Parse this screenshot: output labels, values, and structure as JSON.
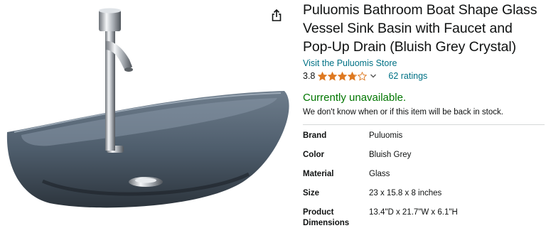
{
  "product": {
    "title": "Puluomis Bathroom Boat Shape Glass Vessel Sink Basin with Faucet and Pop-Up Drain (Bluish Grey Crystal)",
    "store_link": "Visit the Puluomis Store",
    "rating": {
      "value": "3.8",
      "stars": 3.8,
      "out_of": 5,
      "count_label": "62 ratings"
    },
    "availability": {
      "status": "Currently unavailable.",
      "note": "We don't know when or if this item will be back in stock."
    },
    "specs": [
      {
        "label": "Brand",
        "value": "Puluomis"
      },
      {
        "label": "Color",
        "value": "Bluish Grey"
      },
      {
        "label": "Material",
        "value": "Glass"
      },
      {
        "label": "Size",
        "value": "23 x 15.8 x 8 inches"
      },
      {
        "label": "Product Dimensions",
        "value": "13.4\"D x 21.7\"W x 6.1\"H"
      }
    ]
  },
  "icons": {
    "share": "share-icon",
    "star": "star-icon",
    "chevron": "chevron-down-icon"
  },
  "colors": {
    "link": "#007185",
    "available_status": "#007600",
    "star": "#de7921"
  }
}
